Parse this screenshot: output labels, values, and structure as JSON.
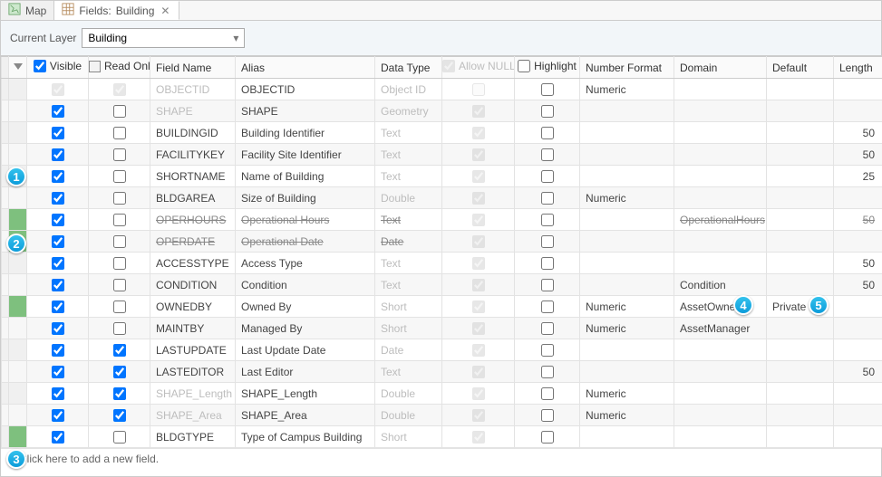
{
  "tabs": {
    "map": "Map",
    "fields_prefix": "Fields:",
    "fields_layer": "Building"
  },
  "layerbar": {
    "label": "Current Layer",
    "value": "Building"
  },
  "columns": {
    "visible": "Visible",
    "readonly": "Read Only",
    "fieldname": "Field Name",
    "alias": "Alias",
    "datatype": "Data Type",
    "allownull": "Allow NULL",
    "highlight": "Highlight",
    "numberformat": "Number Format",
    "domain": "Domain",
    "default": "Default",
    "length": "Length"
  },
  "rows": [
    {
      "visible": true,
      "vdis": true,
      "readonly": true,
      "rodis": true,
      "field": "OBJECTID",
      "fsys": true,
      "alias": "OBJECTID",
      "dtype": "Object ID",
      "dtdis": true,
      "anull": false,
      "anulldis": true,
      "hl": false,
      "hldis": false,
      "numfmt": "Numeric",
      "domain": "",
      "def": "",
      "len": "",
      "alt": false,
      "marker": "",
      "strike": false
    },
    {
      "visible": true,
      "vdis": false,
      "readonly": false,
      "rodis": false,
      "field": "SHAPE",
      "fsys": true,
      "alias": "SHAPE",
      "dtype": "Geometry",
      "dtdis": true,
      "anull": true,
      "anulldis": true,
      "hl": false,
      "hldis": false,
      "numfmt": "",
      "domain": "",
      "def": "",
      "len": "",
      "alt": true,
      "marker": "",
      "strike": false
    },
    {
      "visible": true,
      "vdis": false,
      "readonly": false,
      "rodis": false,
      "field": "BUILDINGID",
      "fsys": false,
      "alias": "Building Identifier",
      "dtype": "Text",
      "dtdis": true,
      "anull": true,
      "anulldis": true,
      "hl": false,
      "hldis": false,
      "numfmt": "",
      "domain": "",
      "def": "",
      "len": "50",
      "alt": false,
      "marker": "",
      "strike": false
    },
    {
      "visible": true,
      "vdis": false,
      "readonly": false,
      "rodis": false,
      "field": "FACILITYKEY",
      "fsys": false,
      "alias": "Facility Site Identifier",
      "dtype": "Text",
      "dtdis": true,
      "anull": true,
      "anulldis": true,
      "hl": false,
      "hldis": false,
      "numfmt": "",
      "domain": "",
      "def": "",
      "len": "50",
      "alt": true,
      "marker": "",
      "strike": false
    },
    {
      "visible": true,
      "vdis": false,
      "readonly": false,
      "rodis": false,
      "field": "SHORTNAME",
      "fsys": false,
      "alias": "Name of Building",
      "dtype": "Text",
      "dtdis": true,
      "anull": true,
      "anulldis": true,
      "hl": false,
      "hldis": false,
      "numfmt": "",
      "domain": "",
      "def": "",
      "len": "25",
      "alt": false,
      "marker": "",
      "strike": false
    },
    {
      "visible": true,
      "vdis": false,
      "readonly": false,
      "rodis": false,
      "field": "BLDGAREA",
      "fsys": false,
      "alias": "Size of Building",
      "dtype": "Double",
      "dtdis": true,
      "anull": true,
      "anulldis": true,
      "hl": false,
      "hldis": false,
      "numfmt": "Numeric",
      "domain": "",
      "def": "",
      "len": "",
      "alt": true,
      "marker": "",
      "strike": false
    },
    {
      "visible": true,
      "vdis": false,
      "readonly": false,
      "rodis": false,
      "field": "OPERHOURS",
      "fsys": false,
      "alias": "Operational Hours",
      "dtype": "Text",
      "dtdis": true,
      "anull": true,
      "anulldis": true,
      "hl": false,
      "hldis": false,
      "numfmt": "",
      "domain": "OperationalHours",
      "def": "",
      "len": "50",
      "alt": false,
      "marker": "hl",
      "strike": true
    },
    {
      "visible": true,
      "vdis": false,
      "readonly": false,
      "rodis": false,
      "field": "OPERDATE",
      "fsys": false,
      "alias": "Operational Date",
      "dtype": "Date",
      "dtdis": true,
      "anull": true,
      "anulldis": true,
      "hl": false,
      "hldis": false,
      "numfmt": "",
      "domain": "",
      "def": "",
      "len": "",
      "alt": true,
      "marker": "hl",
      "strike": true
    },
    {
      "visible": true,
      "vdis": false,
      "readonly": false,
      "rodis": false,
      "field": "ACCESSTYPE",
      "fsys": false,
      "alias": "Access Type",
      "dtype": "Text",
      "dtdis": true,
      "anull": true,
      "anulldis": true,
      "hl": false,
      "hldis": false,
      "numfmt": "",
      "domain": "",
      "def": "",
      "len": "50",
      "alt": false,
      "marker": "",
      "strike": false
    },
    {
      "visible": true,
      "vdis": false,
      "readonly": false,
      "rodis": false,
      "field": "CONDITION",
      "fsys": false,
      "alias": "Condition",
      "dtype": "Text",
      "dtdis": true,
      "anull": true,
      "anulldis": true,
      "hl": false,
      "hldis": false,
      "numfmt": "",
      "domain": "Condition",
      "def": "",
      "len": "50",
      "alt": true,
      "marker": "",
      "strike": false
    },
    {
      "visible": true,
      "vdis": false,
      "readonly": false,
      "rodis": false,
      "field": "OWNEDBY",
      "fsys": false,
      "alias": "Owned By",
      "dtype": "Short",
      "dtdis": true,
      "anull": true,
      "anulldis": true,
      "hl": false,
      "hldis": false,
      "numfmt": "Numeric",
      "domain": "AssetOwner",
      "def": "Private",
      "len": "",
      "alt": false,
      "marker": "hl",
      "strike": false
    },
    {
      "visible": true,
      "vdis": false,
      "readonly": false,
      "rodis": false,
      "field": "MAINTBY",
      "fsys": false,
      "alias": "Managed By",
      "dtype": "Short",
      "dtdis": true,
      "anull": true,
      "anulldis": true,
      "hl": false,
      "hldis": false,
      "numfmt": "Numeric",
      "domain": "AssetManager",
      "def": "",
      "len": "",
      "alt": true,
      "marker": "",
      "strike": false
    },
    {
      "visible": true,
      "vdis": false,
      "readonly": true,
      "rodis": false,
      "field": "LASTUPDATE",
      "fsys": false,
      "alias": "Last Update Date",
      "dtype": "Date",
      "dtdis": true,
      "anull": true,
      "anulldis": true,
      "hl": false,
      "hldis": false,
      "numfmt": "",
      "domain": "",
      "def": "",
      "len": "",
      "alt": false,
      "marker": "",
      "strike": false
    },
    {
      "visible": true,
      "vdis": false,
      "readonly": true,
      "rodis": false,
      "field": "LASTEDITOR",
      "fsys": false,
      "alias": "Last Editor",
      "dtype": "Text",
      "dtdis": true,
      "anull": true,
      "anulldis": true,
      "hl": false,
      "hldis": false,
      "numfmt": "",
      "domain": "",
      "def": "",
      "len": "50",
      "alt": true,
      "marker": "",
      "strike": false
    },
    {
      "visible": true,
      "vdis": false,
      "readonly": true,
      "rodis": false,
      "field": "SHAPE_Length",
      "fsys": true,
      "alias": "SHAPE_Length",
      "dtype": "Double",
      "dtdis": true,
      "anull": true,
      "anulldis": true,
      "hl": false,
      "hldis": false,
      "numfmt": "Numeric",
      "domain": "",
      "def": "",
      "len": "",
      "alt": false,
      "marker": "",
      "strike": false
    },
    {
      "visible": true,
      "vdis": false,
      "readonly": true,
      "rodis": false,
      "field": "SHAPE_Area",
      "fsys": true,
      "alias": "SHAPE_Area",
      "dtype": "Double",
      "dtdis": true,
      "anull": true,
      "anulldis": true,
      "hl": false,
      "hldis": false,
      "numfmt": "Numeric",
      "domain": "",
      "def": "",
      "len": "",
      "alt": true,
      "marker": "",
      "strike": false
    },
    {
      "visible": true,
      "vdis": false,
      "readonly": false,
      "rodis": false,
      "field": "BLDGTYPE",
      "fsys": false,
      "alias": "Type of Campus Building",
      "dtype": "Short",
      "dtdis": true,
      "anull": true,
      "anulldis": true,
      "hl": false,
      "hldis": false,
      "numfmt": "",
      "domain": "",
      "def": "",
      "len": "",
      "alt": false,
      "marker": "hl",
      "strike": false
    }
  ],
  "addrow": "Click here to add a new field.",
  "callouts": {
    "1": "1",
    "2": "2",
    "3": "3",
    "4": "4",
    "5": "5"
  }
}
